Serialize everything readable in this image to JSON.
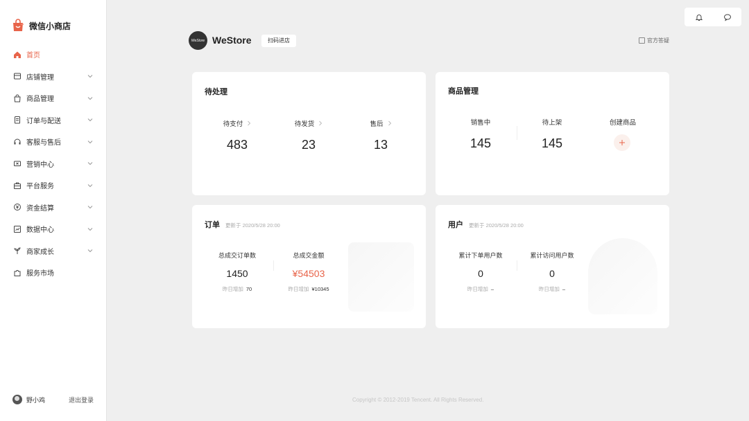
{
  "brand": {
    "name": "微信小商店"
  },
  "nav": [
    {
      "label": "首页",
      "icon": "home-icon",
      "active": true,
      "chevron": false
    },
    {
      "label": "店铺管理",
      "icon": "store-icon",
      "chevron": true
    },
    {
      "label": "商品管理",
      "icon": "bag-icon",
      "chevron": true
    },
    {
      "label": "订单与配送",
      "icon": "order-icon",
      "chevron": true
    },
    {
      "label": "客服与售后",
      "icon": "headset-icon",
      "chevron": true
    },
    {
      "label": "营销中心",
      "icon": "ticket-icon",
      "chevron": true
    },
    {
      "label": "平台服务",
      "icon": "briefcase-icon",
      "chevron": true
    },
    {
      "label": "资金结算",
      "icon": "yuan-icon",
      "chevron": true
    },
    {
      "label": "数据中心",
      "icon": "chart-icon",
      "chevron": true
    },
    {
      "label": "商家成长",
      "icon": "sprout-icon",
      "chevron": true
    },
    {
      "label": "服务市场",
      "icon": "puzzle-icon",
      "chevron": false
    }
  ],
  "user": {
    "name": "野小鸡",
    "logout": "退出登录"
  },
  "header": {
    "store_name": "WeStore",
    "logo_text": "WeStore",
    "scan_label": "扫码进店",
    "faq_label": "官方答疑"
  },
  "pending": {
    "title": "待处理",
    "items": [
      {
        "label": "待支付",
        "value": "483"
      },
      {
        "label": "待发货",
        "value": "23"
      },
      {
        "label": "售后",
        "value": "13"
      }
    ]
  },
  "products": {
    "title": "商品管理",
    "items": [
      {
        "label": "销售中",
        "value": "145"
      },
      {
        "label": "待上架",
        "value": "145"
      }
    ],
    "create_label": "创建商品"
  },
  "orders": {
    "title": "订单",
    "updated": "更新于 2020/5/28 20:00",
    "total_orders_label": "总成交订单数",
    "total_orders": "1450",
    "total_orders_sub_label": "昨日增加",
    "total_orders_sub": "70",
    "total_amount_label": "总成交金额",
    "total_amount": "¥54503",
    "total_amount_sub_label": "昨日增加",
    "total_amount_sub": "¥10345"
  },
  "users": {
    "title": "用户",
    "updated": "更新于 2020/5/28 20:00",
    "order_users_label": "累计下单用户数",
    "order_users": "0",
    "order_users_sub_label": "昨日增加",
    "order_users_sub": "–",
    "visit_users_label": "累计访问用户数",
    "visit_users": "0",
    "visit_users_sub_label": "昨日增加",
    "visit_users_sub": "–"
  },
  "footer": {
    "copyright": "Copyright © 2012-2019 Tencent. All Rights Reserved."
  },
  "colors": {
    "accent": "#e8644a",
    "background": "#efefef"
  }
}
